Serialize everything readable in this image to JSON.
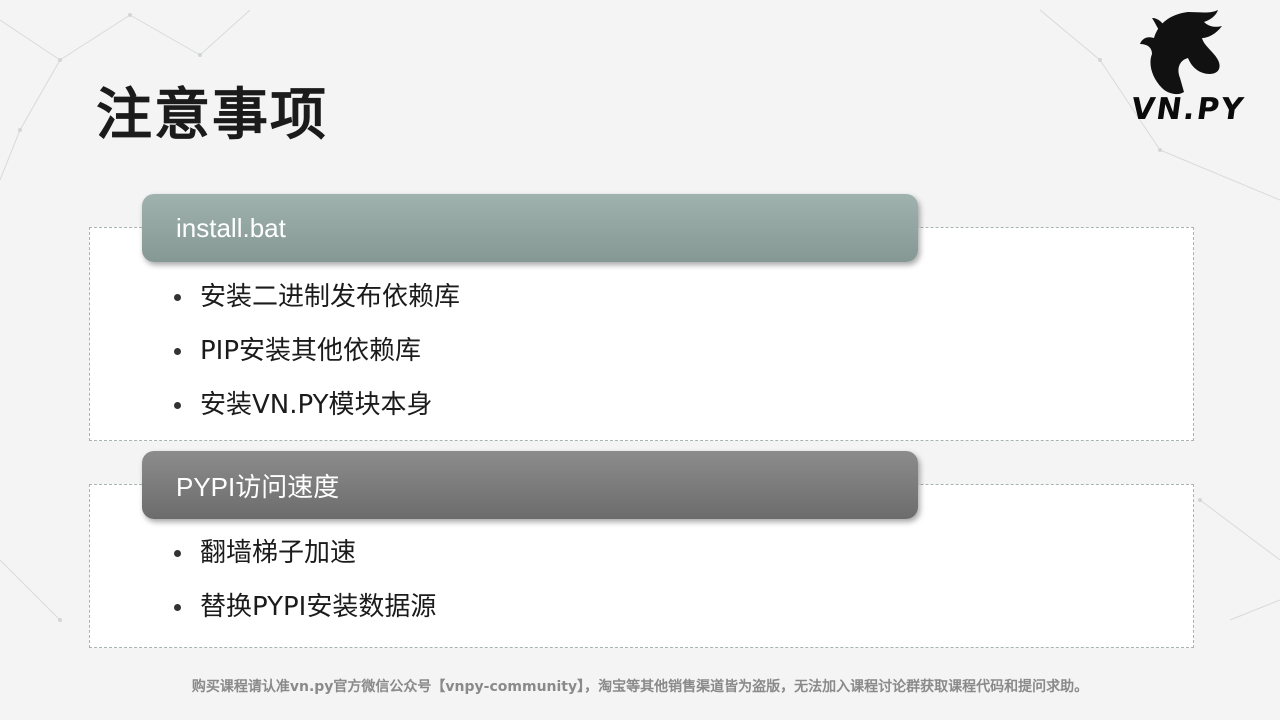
{
  "title": "注意事项",
  "logo": {
    "text": "VN.PY",
    "icon": "horse-head-icon"
  },
  "sections": [
    {
      "header": "install.bat",
      "items": [
        "安装二进制发布依赖库",
        "PIP安装其他依赖库",
        "安装VN.PY模块本身"
      ]
    },
    {
      "header": "PYPI访问速度",
      "items": [
        "翻墙梯子加速",
        "替换PYPI安装数据源"
      ]
    }
  ],
  "footer": "购买课程请认准vn.py官方微信公众号【vnpy-community】，淘宝等其他销售渠道皆为盗版，无法加入课程讨论群获取课程代码和提问求助。",
  "colors": {
    "pill1": "#94a7a2",
    "pill2": "#7a7a7a",
    "border": "#a9b4b2"
  }
}
